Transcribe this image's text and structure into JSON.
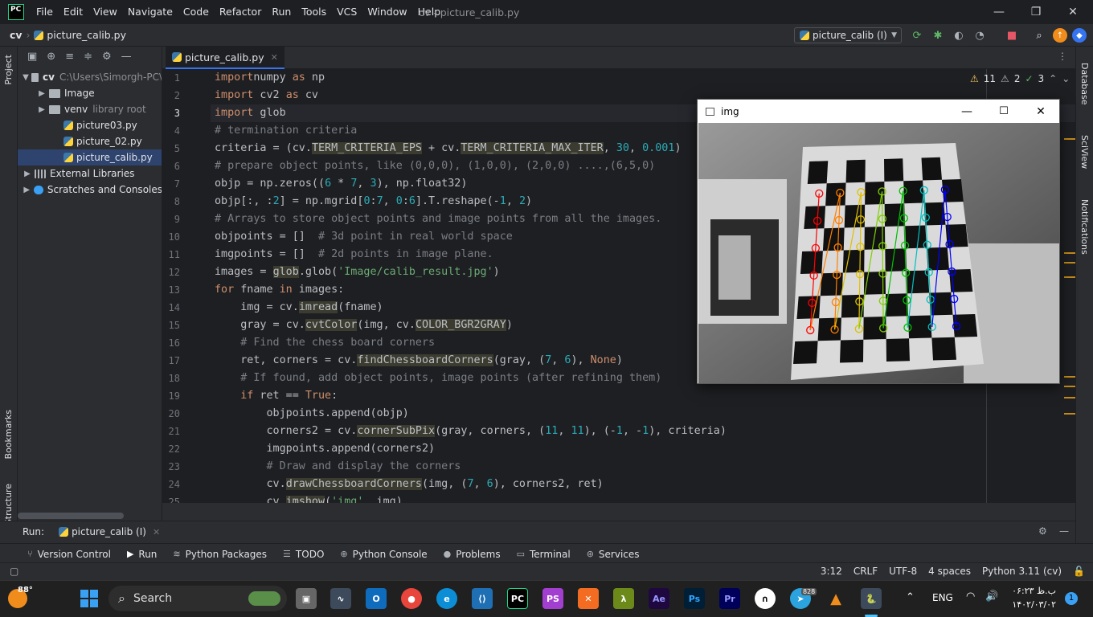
{
  "titlebar": {
    "logo": "PC",
    "menu": [
      "File",
      "Edit",
      "View",
      "Navigate",
      "Code",
      "Refactor",
      "Run",
      "Tools",
      "VCS",
      "Window",
      "Help"
    ],
    "title": "cv - picture_calib.py"
  },
  "nav": {
    "project": "cv",
    "file": "picture_calib.py",
    "run_config": "picture_calib (I)"
  },
  "left_stripe": {
    "project": "Project",
    "bookmarks": "Bookmarks",
    "structure": "Structure"
  },
  "right_stripe": {
    "database": "Database",
    "sciview": "SciView",
    "notifications": "Notifications"
  },
  "project_tree": [
    {
      "label": "cv",
      "extra": "C:\\Users\\Simorgh-PC\\",
      "indent": 0,
      "arrow": "▼",
      "icon": "folder"
    },
    {
      "label": "Image",
      "extra": "",
      "indent": 1,
      "arrow": "▶",
      "icon": "folder"
    },
    {
      "label": "venv",
      "extra": "library root",
      "indent": 1,
      "arrow": "▶",
      "icon": "folder"
    },
    {
      "label": "picture03.py",
      "extra": "",
      "indent": 2,
      "arrow": "",
      "icon": "py"
    },
    {
      "label": "picture_02.py",
      "extra": "",
      "indent": 2,
      "arrow": "",
      "icon": "py"
    },
    {
      "label": "picture_calib.py",
      "extra": "",
      "indent": 2,
      "arrow": "",
      "icon": "py",
      "selected": true
    },
    {
      "label": "External Libraries",
      "extra": "",
      "indent": 0,
      "arrow": "▶",
      "icon": "lib"
    },
    {
      "label": "Scratches and Consoles",
      "extra": "",
      "indent": 0,
      "arrow": "▶",
      "icon": "scratch"
    }
  ],
  "editor": {
    "tab": "picture_calib.py",
    "warnings": "11",
    "weak": "2",
    "ok": "3",
    "lines": [
      [
        [
          "kw",
          "import"
        ],
        [
          "",
          "numpy "
        ],
        [
          "kw",
          "as"
        ],
        [
          "",
          " np"
        ]
      ],
      [
        [
          "kw",
          "import"
        ],
        [
          "",
          " cv2 "
        ],
        [
          "kw",
          "as"
        ],
        [
          "",
          " cv"
        ]
      ],
      [
        [
          "kw",
          "import"
        ],
        [
          "",
          " glob"
        ]
      ],
      [
        [
          "cm",
          "# termination criteria"
        ]
      ],
      [
        [
          "",
          "criteria = (cv."
        ],
        [
          "hl",
          "TERM_CRITERIA_EPS"
        ],
        [
          "",
          " + cv."
        ],
        [
          "hl",
          "TERM_CRITERIA_MAX_ITER"
        ],
        [
          "",
          ", "
        ],
        [
          "nm",
          "30"
        ],
        [
          "",
          ", "
        ],
        [
          "nm",
          "0.001"
        ],
        [
          "",
          ")"
        ]
      ],
      [
        [
          "cm",
          "# prepare object points, like (0,0,0), (1,0,0), (2,0,0) ....,(6,5,0)"
        ]
      ],
      [
        [
          "",
          "objp = np.zeros(("
        ],
        [
          "nm",
          "6"
        ],
        [
          "",
          " * "
        ],
        [
          "nm",
          "7"
        ],
        [
          "",
          ", "
        ],
        [
          "nm",
          "3"
        ],
        [
          "",
          "), np.float32)"
        ]
      ],
      [
        [
          "",
          "objp[:, :"
        ],
        [
          "nm",
          "2"
        ],
        [
          "",
          "] = np.mgrid["
        ],
        [
          "nm",
          "0"
        ],
        [
          "",
          ":"
        ],
        [
          "nm",
          "7"
        ],
        [
          "",
          ", "
        ],
        [
          "nm",
          "0"
        ],
        [
          "",
          ":"
        ],
        [
          "nm",
          "6"
        ],
        [
          "",
          "].T.reshape(-"
        ],
        [
          "nm",
          "1"
        ],
        [
          "",
          ", "
        ],
        [
          "nm",
          "2"
        ],
        [
          "",
          ")"
        ]
      ],
      [
        [
          "cm",
          "# Arrays to store object points and image points from all the images."
        ]
      ],
      [
        [
          "",
          "objpoints = []  "
        ],
        [
          "cm",
          "# 3d point in real world space"
        ]
      ],
      [
        [
          "",
          "imgpoints = []  "
        ],
        [
          "cm",
          "# 2d points in image plane."
        ]
      ],
      [
        [
          "",
          "images = "
        ],
        [
          "hl",
          "glob"
        ],
        [
          "",
          ".glob("
        ],
        [
          "st",
          "'Image/calib_result.jpg'"
        ],
        [
          "",
          ")"
        ]
      ],
      [
        [
          "kw",
          "for"
        ],
        [
          "",
          " fname "
        ],
        [
          "kw",
          "in"
        ],
        [
          "",
          " images:"
        ]
      ],
      [
        [
          "",
          "    img = cv."
        ],
        [
          "hl",
          "imread"
        ],
        [
          "",
          "(fname)"
        ]
      ],
      [
        [
          "",
          "    gray = cv."
        ],
        [
          "hl",
          "cvtColor"
        ],
        [
          "",
          "(img, cv."
        ],
        [
          "hl",
          "COLOR_BGR2GRAY"
        ],
        [
          "",
          ")"
        ]
      ],
      [
        [
          "cm",
          "    # Find the chess board corners"
        ]
      ],
      [
        [
          "",
          "    ret, corners = cv."
        ],
        [
          "hl",
          "findChessboardCorners"
        ],
        [
          "",
          "(gray, ("
        ],
        [
          "nm",
          "7"
        ],
        [
          "",
          ", "
        ],
        [
          "nm",
          "6"
        ],
        [
          "",
          "), "
        ],
        [
          "kw",
          "None"
        ],
        [
          "",
          ")"
        ]
      ],
      [
        [
          "cm",
          "    # If found, add object points, image points (after refining them)"
        ]
      ],
      [
        [
          "",
          "    "
        ],
        [
          "kw",
          "if"
        ],
        [
          "",
          " ret == "
        ],
        [
          "kw",
          "True"
        ],
        [
          "",
          ":"
        ]
      ],
      [
        [
          "",
          "        objpoints.append(objp)"
        ]
      ],
      [
        [
          "",
          "        corners2 = cv."
        ],
        [
          "hl",
          "cornerSubPix"
        ],
        [
          "",
          "(gray, corners, ("
        ],
        [
          "nm",
          "11"
        ],
        [
          "",
          ", "
        ],
        [
          "nm",
          "11"
        ],
        [
          "",
          "), (-"
        ],
        [
          "nm",
          "1"
        ],
        [
          "",
          ", -"
        ],
        [
          "nm",
          "1"
        ],
        [
          "",
          "), criteria)"
        ]
      ],
      [
        [
          "",
          "        imgpoints.append(corners2)"
        ]
      ],
      [
        [
          "cm",
          "        # Draw and display the corners"
        ]
      ],
      [
        [
          "",
          "        cv."
        ],
        [
          "hl",
          "drawChessboardCorners"
        ],
        [
          "",
          "(img, ("
        ],
        [
          "nm",
          "7"
        ],
        [
          "",
          ", "
        ],
        [
          "nm",
          "6"
        ],
        [
          "",
          "), corners2, ret)"
        ]
      ],
      [
        [
          "",
          "        cv."
        ],
        [
          "hl",
          "imshow"
        ],
        [
          "",
          "("
        ],
        [
          "st",
          "'img'"
        ],
        [
          "",
          ", img)"
        ]
      ]
    ]
  },
  "img_window": {
    "title": "img"
  },
  "run": {
    "label": "Run:",
    "config": "picture_calib (I)"
  },
  "tool_windows": [
    "Version Control",
    "Run",
    "Python Packages",
    "TODO",
    "Python Console",
    "Problems",
    "Terminal",
    "Services"
  ],
  "status": {
    "pos": "3:12",
    "eol": "CRLF",
    "enc": "UTF-8",
    "indent": "4 spaces",
    "interp": "Python 3.11 (cv)"
  },
  "taskbar": {
    "weather": "88°",
    "search": "Search",
    "lang": "ENG",
    "time": "۰۶:۲۳ ب.ظ",
    "date": "۱۴۰۲/۰۳/۰۲",
    "tg_badge": "828",
    "notif": "1"
  }
}
